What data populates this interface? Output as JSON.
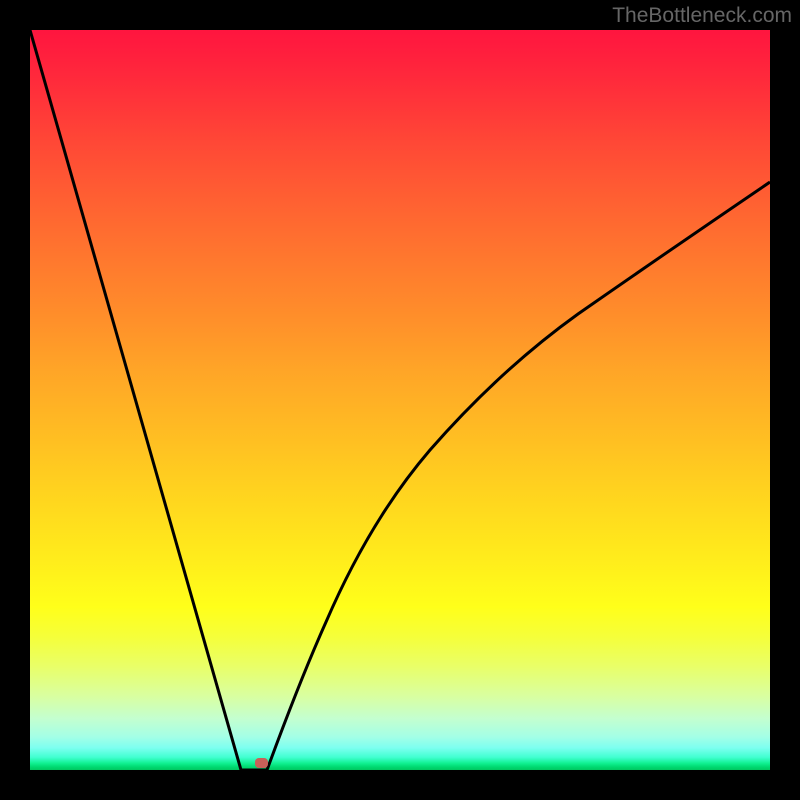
{
  "attribution": "TheBottleneck.com",
  "colors": {
    "frame": "#000000",
    "curve": "#000000",
    "marker": "#c86058",
    "attribution_text": "#666666"
  },
  "chart_data": {
    "type": "line",
    "title": "",
    "xlabel": "",
    "ylabel": "",
    "xlim": [
      0,
      100
    ],
    "ylim": [
      0,
      100
    ],
    "grid": false,
    "legend": false,
    "background_gradient_top": "#ff153f",
    "background_gradient_bottom": "#00c860",
    "series": [
      {
        "name": "bottleneck-curve-left",
        "x": [
          0.0,
          2.0,
          4.0,
          6.0,
          8.0,
          10.0,
          12.0,
          14.0,
          16.0,
          18.0,
          20.0,
          22.0,
          24.0,
          26.0,
          27.5,
          28.6
        ],
        "values": [
          100.0,
          92.8,
          85.6,
          78.4,
          71.2,
          64.0,
          56.8,
          49.6,
          42.4,
          35.2,
          28.0,
          20.8,
          13.6,
          6.4,
          1.0,
          0.0
        ]
      },
      {
        "name": "minimum-flat",
        "x": [
          28.6,
          32.0
        ],
        "values": [
          0.0,
          0.0
        ]
      },
      {
        "name": "bottleneck-curve-right",
        "x": [
          32.0,
          34.0,
          36.0,
          38.0,
          40.0,
          44.0,
          48.0,
          52.0,
          56.0,
          60.0,
          64.0,
          68.0,
          72.0,
          76.0,
          80.0,
          84.0,
          88.0,
          92.0,
          96.0,
          100.0
        ],
        "values": [
          0.0,
          5.0,
          10.5,
          15.5,
          20.0,
          28.0,
          35.0,
          41.0,
          46.5,
          51.5,
          56.0,
          60.0,
          63.5,
          66.5,
          69.3,
          71.8,
          74.0,
          76.0,
          77.8,
          79.5
        ]
      }
    ],
    "marker": {
      "name": "current-config-marker",
      "x": 31.2,
      "y": 0.6,
      "shape": "rounded-rect",
      "color": "#c86058"
    }
  }
}
